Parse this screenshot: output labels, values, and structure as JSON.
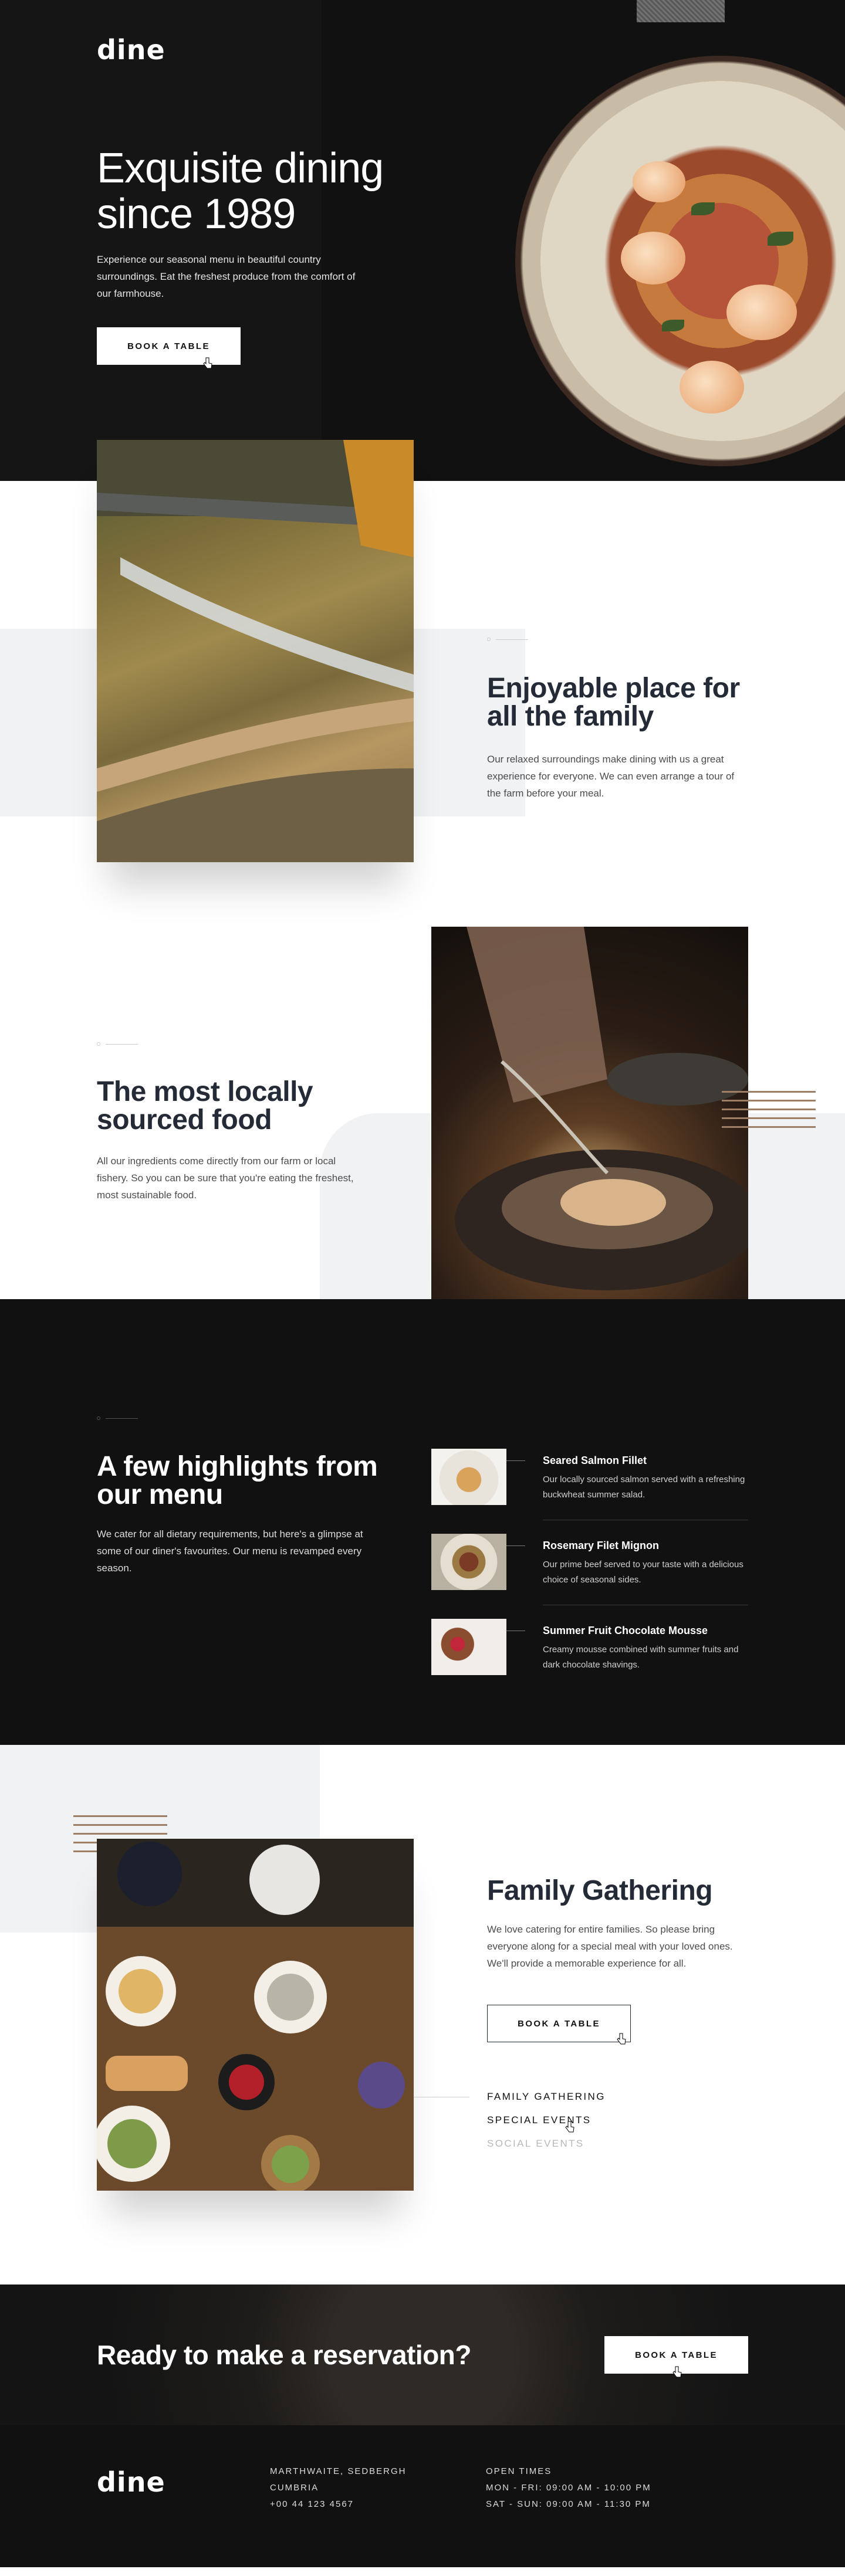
{
  "brand": {
    "logo": "dine"
  },
  "hero": {
    "title": "Exquisite dining since 1989",
    "text": "Experience our seasonal menu in beautiful country surroundings. Eat the freshest produce from the comfort of our farmhouse.",
    "cta": "BOOK A TABLE"
  },
  "enjoyable": {
    "title": "Enjoyable place for all the family",
    "text": "Our relaxed surroundings make dining with us a great experience for everyone. We can even arrange a tour of the farm before your meal."
  },
  "local": {
    "title": "The most locally sourced food",
    "text": "All our ingredients come directly from our farm or local fishery. So you can be sure that you're eating the freshest, most sustainable food."
  },
  "menu": {
    "title": "A few highlights from our menu",
    "text": "We cater for all dietary requirements, but here's a glimpse at some of our diner's favourites. Our menu is revamped every season.",
    "items": [
      {
        "name": "Seared Salmon Fillet",
        "desc": "Our locally sourced salmon served with a refreshing buckwheat summer salad."
      },
      {
        "name": "Rosemary Filet Mignon",
        "desc": "Our prime beef served to your taste with a delicious choice of seasonal sides."
      },
      {
        "name": "Summer Fruit Chocolate Mousse",
        "desc": "Creamy mousse combined with summer fruits and dark chocolate shavings."
      }
    ]
  },
  "family": {
    "title": "Family Gathering",
    "text": "We love catering for entire families. So please bring everyone along for a special meal with your loved ones. We'll provide a memorable experience for all.",
    "cta": "BOOK A TABLE",
    "tabs": [
      "FAMILY GATHERING",
      "SPECIAL EVENTS",
      "SOCIAL EVENTS"
    ]
  },
  "reservation": {
    "title": "Ready to make a reservation?",
    "cta": "BOOK A TABLE"
  },
  "footer": {
    "address": [
      "MARTHWAITE, SEDBERGH",
      "CUMBRIA",
      "+00 44 123 4567"
    ],
    "hours": [
      "OPEN TIMES",
      "MON - FRI: 09:00 AM - 10:00 PM",
      "SAT - SUN: 09:00 AM - 11:30 PM"
    ]
  },
  "colors": {
    "dark": "#111111",
    "accent": "#9e7f66",
    "panel": "#f1f2f4",
    "heading": "#242b37"
  }
}
